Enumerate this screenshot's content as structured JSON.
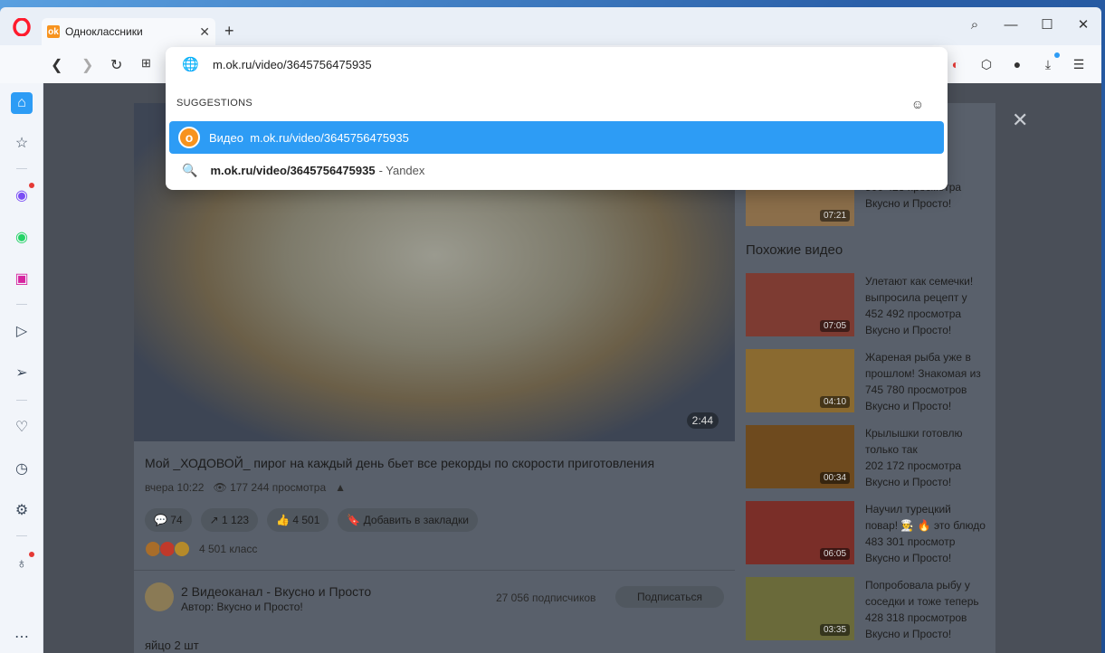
{
  "browser": {
    "tab_title": "Одноклассники",
    "new_tab": "+",
    "window_controls": [
      "⌕",
      "—",
      "☐",
      "✕"
    ]
  },
  "address_bar": {
    "url": "m.ok.ru/video/3645756475935",
    "suggestions_header": "SUGGESTIONS",
    "suggestions": [
      {
        "prefix": "Видео",
        "text": "m.ok.ru/video/3645756475935",
        "engine": ""
      },
      {
        "prefix": "",
        "text": "m.ok.ru/video/3645756475935",
        "engine": "- Yandex"
      }
    ]
  },
  "video": {
    "duration": "2:44",
    "title": "Мой _ХОДОВОЙ_ пирог на каждый день бьет все рекорды по скорости приготовления",
    "posted": "вчера 10:22",
    "views": "177 244 просмотра",
    "comments": "74",
    "shares": "1 123",
    "likes": "4 501",
    "bookmark": "Добавить в закладки",
    "classes": "4 501 класс",
    "channel_name": "2 Видеоканал - Вкусно и Просто",
    "channel_author": "Автор: Вкусно и Просто!",
    "subscribers": "27 056 подписчиков",
    "subscribe": "Подписаться",
    "description_first_line": "яйцо 2 шт"
  },
  "sidebar_videos": {
    "top_item": {
      "duration": "07:21",
      "views": "500 423 просмотра",
      "author": "Вкусно и Просто!"
    },
    "header": "Похожие видео",
    "items": [
      {
        "title1": "Улетают как семечки!",
        "title2": "выпросила рецепт у",
        "views": "452 492 просмотра",
        "author": "Вкусно и Просто!",
        "duration": "07:05"
      },
      {
        "title1": "Жареная рыба уже в",
        "title2": "прошлом! Знакомая из",
        "views": "745 780 просмотров",
        "author": "Вкусно и Просто!",
        "duration": "04:10"
      },
      {
        "title1": "Крылышки готовлю",
        "title2": "только так",
        "views": "202 172 просмотра",
        "author": "Вкусно и Просто!",
        "duration": "00:34"
      },
      {
        "title1": "Научил турецкий",
        "title2": "повар! 👨‍🍳 🔥 это блюдо",
        "views": "483 301 просмотр",
        "author": "Вкусно и Просто!",
        "duration": "06:05"
      },
      {
        "title1": "Попробовала рыбу у",
        "title2": "соседки и тоже теперь",
        "views": "428 318 просмотров",
        "author": "Вкусно и Просто!",
        "duration": "03:35"
      }
    ]
  },
  "colors": {
    "accent": "#2d9cf5",
    "ok_orange": "#f7931e",
    "opera_red": "#ff1b2d"
  }
}
